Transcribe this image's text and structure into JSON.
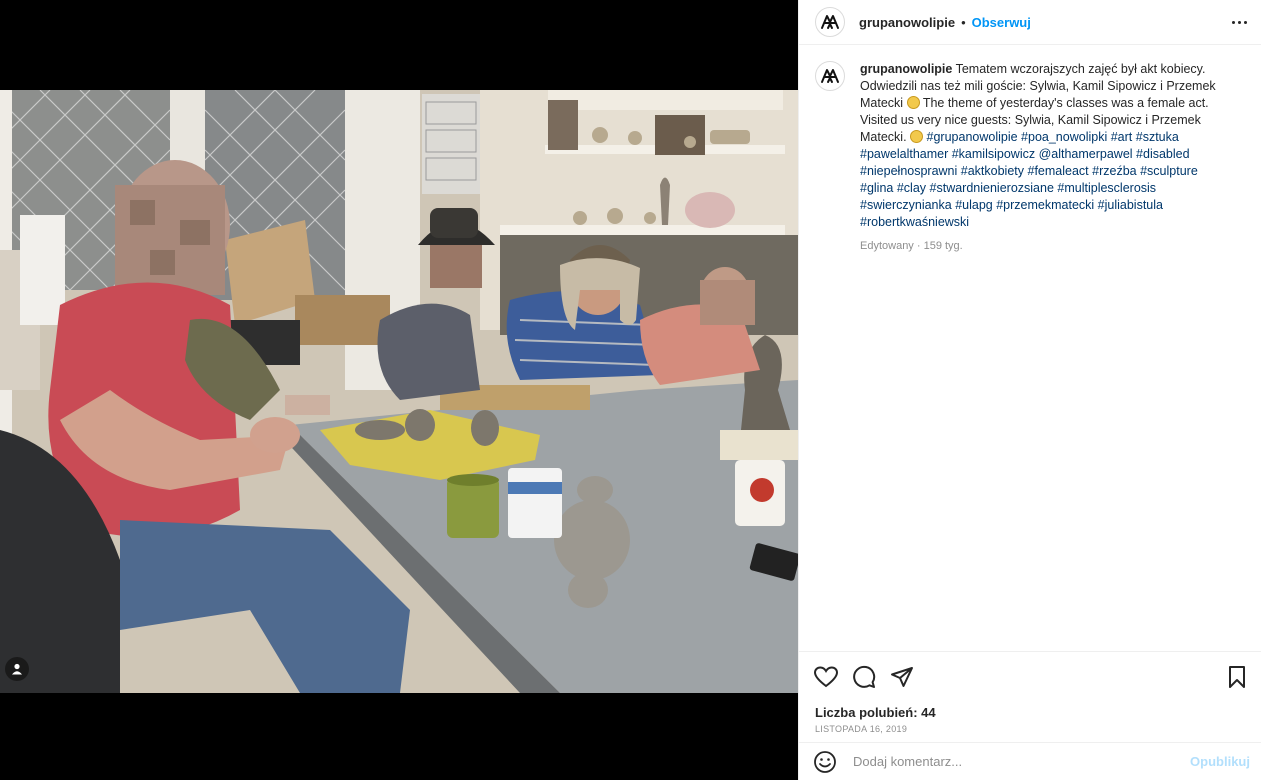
{
  "post": {
    "username": "grupanowolipie",
    "follow_label": "Obserwuj",
    "separator": "•"
  },
  "caption": {
    "username": "grupanowolipie",
    "text_1": "Tematem wczorajszych zajęć był akt kobiecy. Odwiedzili nas też mili goście: Sylwia, Kamil Sipowicz i Przemek Matecki",
    "text_2": "The theme of yesterday's classes was a female act. Visited us very nice guests: Sylwia, Kamil Sipowicz i Przemek Matecki.",
    "hashtags": [
      "#grupanowolipie",
      "#poa_nowolipki",
      "#art",
      "#sztuka",
      "#pawelalthamer",
      "#kamilsipowicz",
      "@althamerpawel",
      "#disabled",
      "#niepełnosprawni",
      "#aktkobiety",
      "#femaleact",
      "#rzeźba",
      "#sculpture",
      "#glina",
      "#clay",
      "#stwardnienierozsiane",
      "#multiplesclerosis",
      "#swierczynianka",
      "#ulapg",
      "#przemekmatecki",
      "#juliabistula",
      "#robertkwaśniewski"
    ],
    "edited": "Edytowany · 159 tyg."
  },
  "stats": {
    "likes": "Liczba polubień: 44",
    "date": "LISTOPADA 16, 2019"
  },
  "comment": {
    "placeholder": "Dodaj komentarz...",
    "publish_label": "Opublikuj"
  },
  "icons": {
    "like": "heart-icon",
    "comment": "comment-icon",
    "share": "paper-plane-icon",
    "save": "bookmark-icon",
    "emoji": "smiley-icon",
    "more": "more-options-icon"
  },
  "colors": {
    "accent": "#0095f6",
    "hashtag": "#00376b",
    "muted": "#8e8e8e",
    "publish_disabled": "#b2dffc"
  }
}
